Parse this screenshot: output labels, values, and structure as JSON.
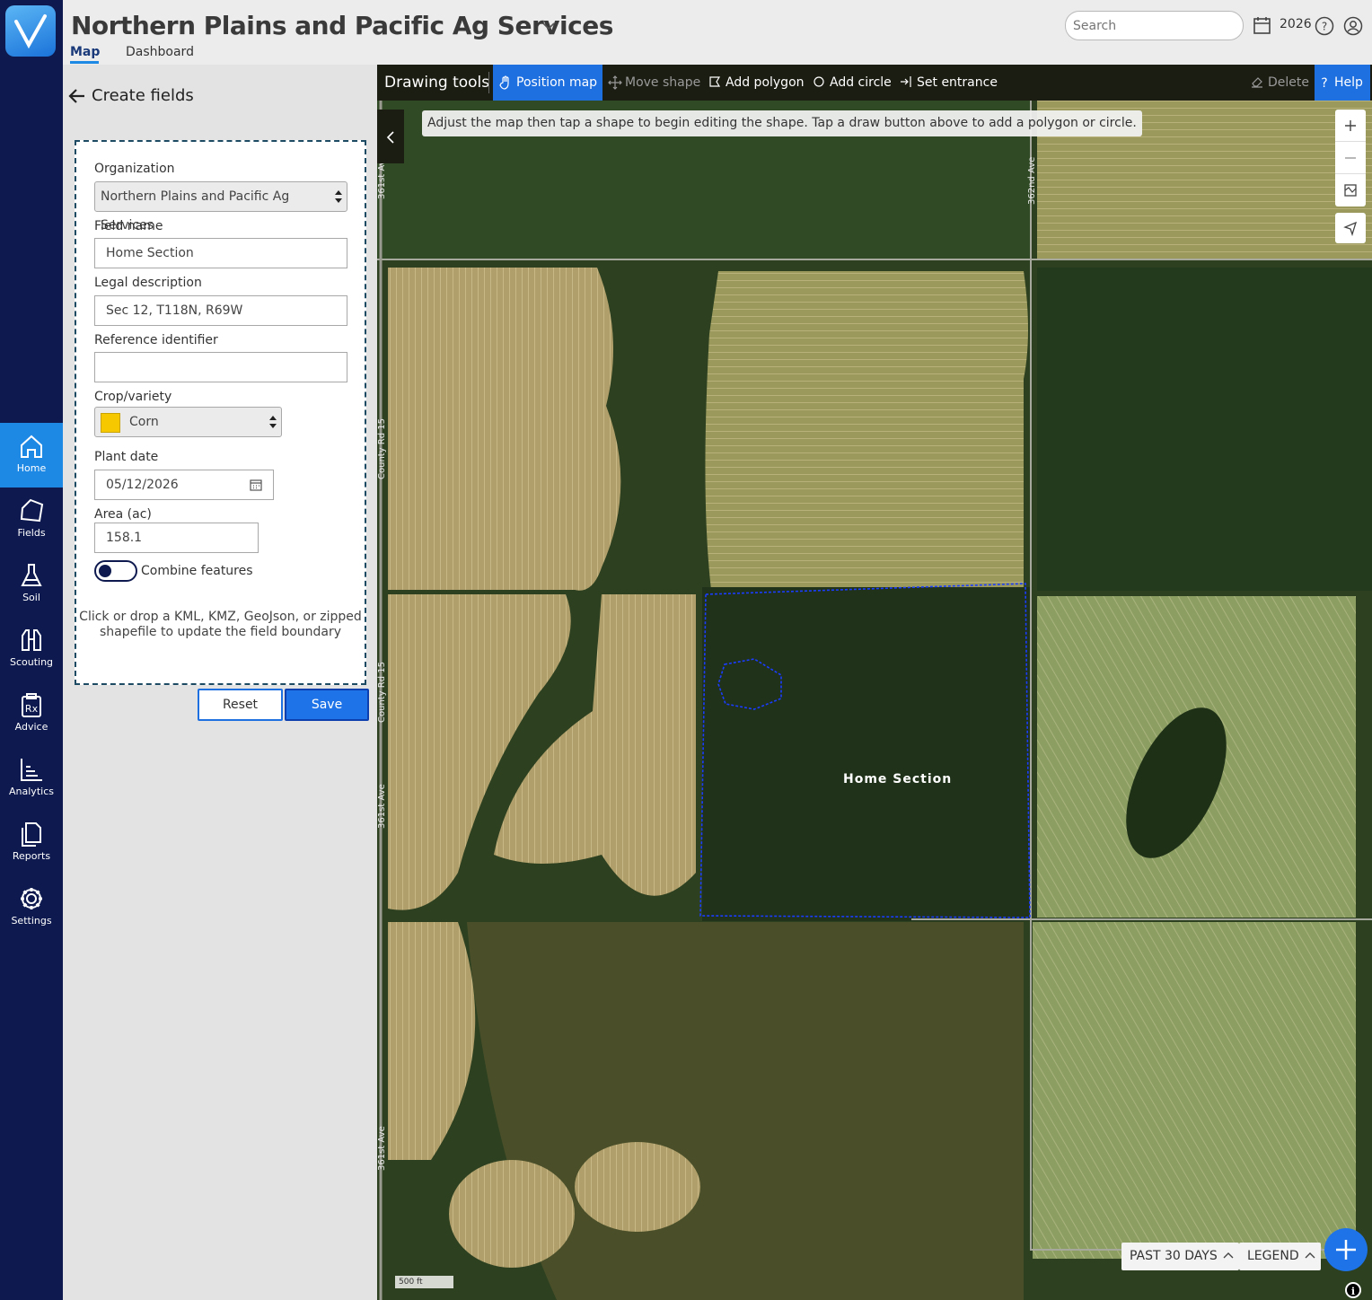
{
  "header": {
    "org_title": "Northern Plains and Pacific Ag Services",
    "tabs": [
      {
        "label": "Map"
      },
      {
        "label": "Dashboard"
      }
    ],
    "search_placeholder": "Search",
    "year": "2026"
  },
  "nav": {
    "items": [
      {
        "label": "Home",
        "icon": "home-icon"
      },
      {
        "label": "Fields",
        "icon": "fields-icon"
      },
      {
        "label": "Soil",
        "icon": "flask-icon"
      },
      {
        "label": "Scouting",
        "icon": "binoculars-icon"
      },
      {
        "label": "Advice",
        "icon": "prescription-icon"
      },
      {
        "label": "Analytics",
        "icon": "chart-icon"
      },
      {
        "label": "Reports",
        "icon": "documents-icon"
      },
      {
        "label": "Settings",
        "icon": "gear-icon"
      }
    ]
  },
  "panel": {
    "title": "Create fields",
    "form": {
      "organization_label": "Organization",
      "organization_value": "Northern Plains and Pacific Ag Services",
      "field_name_label": "Field name",
      "field_name_value": "Home Section",
      "legal_label": "Legal description",
      "legal_value": "Sec 12, T118N, R69W",
      "ref_label": "Reference identifier",
      "ref_value": "",
      "crop_label": "Crop/variety",
      "crop_value": "Corn",
      "crop_color": "#f5c800",
      "plant_date_label": "Plant date",
      "plant_date_value": "05/12/2026",
      "area_label": "Area (ac)",
      "area_value": "158.1",
      "combine_label": "Combine features",
      "drop_note": "Click or drop a KML, KMZ, GeoJson, or zipped shapefile to update the field boundary"
    },
    "reset_label": "Reset",
    "save_label": "Save"
  },
  "toolbar": {
    "title": "Drawing tools",
    "position_map": "Position map",
    "move_shape": "Move shape",
    "add_polygon": "Add polygon",
    "add_circle": "Add circle",
    "set_entrance": "Set entrance",
    "delete": "Delete",
    "help": "Help"
  },
  "map": {
    "hint": "Adjust the map then tap a shape to begin editing the shape. Tap a draw button above to add a polygon or circle.",
    "field_label": "Home Section",
    "roads": [
      "361st Av",
      "362nd Ave",
      "County Rd 15",
      "County Rd 15",
      "361st Ave",
      "361st Ave"
    ],
    "past_days": "PAST 30 DAYS",
    "legend": "LEGEND",
    "scale": "500 ft"
  }
}
